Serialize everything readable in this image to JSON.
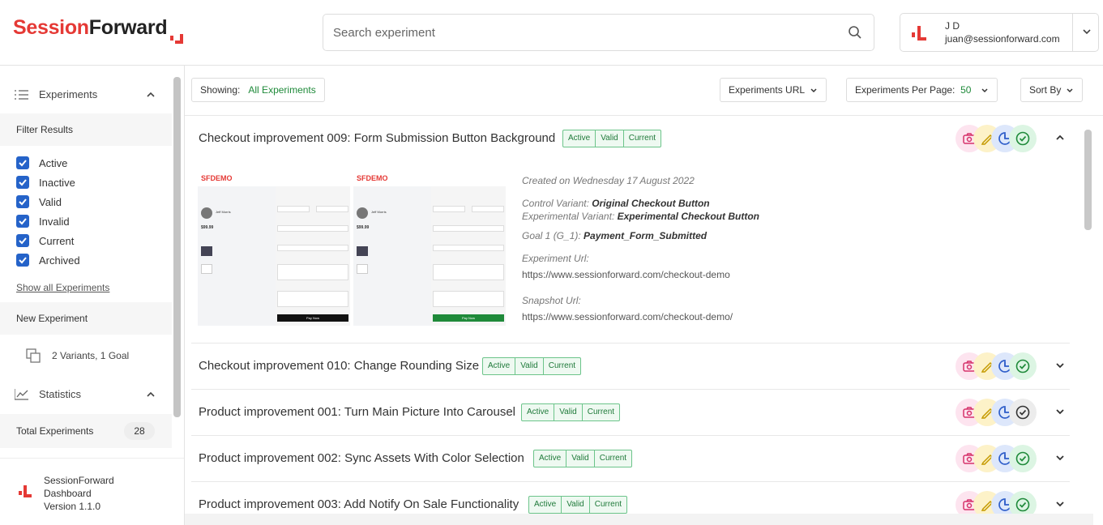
{
  "brand": {
    "part1": "Session",
    "part2": "Forward"
  },
  "search": {
    "placeholder": "Search experiment"
  },
  "user": {
    "name": "J D",
    "email": "juan@sessionforward.com"
  },
  "sidebar": {
    "experiments_label": "Experiments",
    "filter_label": "Filter Results",
    "filters": [
      {
        "label": "Active",
        "checked": true
      },
      {
        "label": "Inactive",
        "checked": true
      },
      {
        "label": "Valid",
        "checked": true
      },
      {
        "label": "Invalid",
        "checked": true
      },
      {
        "label": "Current",
        "checked": true
      },
      {
        "label": "Archived",
        "checked": true
      }
    ],
    "show_all": "Show all Experiments",
    "new_experiment": "New Experiment",
    "variants_goal": "2 Variants, 1 Goal",
    "statistics_label": "Statistics",
    "total_experiments_label": "Total Experiments",
    "total_experiments_value": "28"
  },
  "footer": {
    "line1": "SessionForward",
    "line2": "Dashboard",
    "version": "Version 1.1.0"
  },
  "toolbar": {
    "showing_label": "Showing:",
    "showing_value": "All Experiments",
    "experiments_url": "Experiments URL",
    "per_page_label": "Experiments Per Page:",
    "per_page_value": "50",
    "sort_by": "Sort By"
  },
  "experiments": [
    {
      "title": "Checkout improvement 009: Form Submission Button Background",
      "tags": [
        "Active",
        "Valid",
        "Current"
      ],
      "expanded": true,
      "check_done": true
    },
    {
      "title": "Checkout improvement 010: Change Rounding Size",
      "tags": [
        "Active",
        "Valid",
        "Current"
      ],
      "expanded": false,
      "check_done": true
    },
    {
      "title": "Product improvement 001: Turn Main Picture Into Carousel",
      "tags": [
        "Active",
        "Valid",
        "Current"
      ],
      "expanded": false,
      "check_done": false
    },
    {
      "title": "Product improvement 002: Sync Assets With Color Selection",
      "tags": [
        "Active",
        "Valid",
        "Current"
      ],
      "expanded": false,
      "check_done": true
    },
    {
      "title": "Product improvement 003: Add Notify On Sale Functionality",
      "tags": [
        "Active",
        "Valid",
        "Current"
      ],
      "expanded": false,
      "check_done": true
    }
  ],
  "detail": {
    "created": "Created on Wednesday 17 August 2022",
    "control_label": "Control Variant:",
    "control_value": "Original Checkout Button",
    "experimental_label": "Experimental Variant:",
    "experimental_value": "Experimental Checkout Button",
    "goal_label": "Goal 1 (G_1):",
    "goal_value": "Payment_Form_Submitted",
    "exp_url_label": "Experiment Url:",
    "exp_url_value": "https://www.sessionforward.com/checkout-demo",
    "snap_url_label": "Snapshot Url:",
    "snap_url_value": "https://www.sessionforward.com/checkout-demo/"
  },
  "thumbnails": [
    {
      "brand": "SFDEMO",
      "price": "$99.99",
      "user": "Jeff Morris",
      "button": "Pay Now",
      "button_color": "#111111"
    },
    {
      "brand": "SFDEMO",
      "price": "$99.99",
      "user": "Jeff Morris",
      "button": "Pay Now",
      "button_color": "#1f8a3a"
    }
  ],
  "colors": {
    "brand_red": "#e53935",
    "tag_green": "#1f7a3a",
    "checkbox_blue": "#2563c9"
  },
  "action_icons": [
    "camera-icon",
    "edit-icon",
    "timer-icon",
    "check-circle-icon"
  ]
}
